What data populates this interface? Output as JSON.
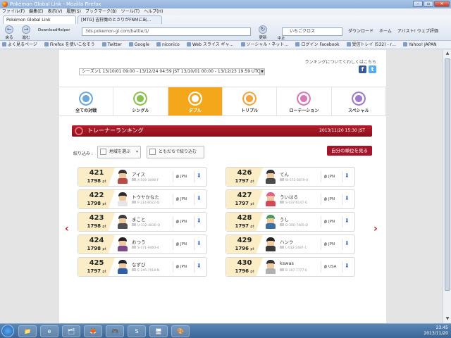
{
  "window": {
    "title": "Pokémon Global Link - Mozilla Firefox",
    "buttons": [
      "–",
      "▫",
      "✕"
    ]
  },
  "menubar": [
    "ファイル(F)",
    "編集(E)",
    "表示(V)",
    "履歴(S)",
    "ブックマーク(B)",
    "ツール(T)",
    "ヘルプ(H)"
  ],
  "tabs": [
    {
      "label": "Pokémon Global Link",
      "active": true
    },
    {
      "label": "[MTG] 吉狩魔のとさりがFNMに出…",
      "active": false
    }
  ],
  "nav": {
    "back": "戻る",
    "forward": "進む",
    "download_helper": "DownloadHelper",
    "reload": "更新",
    "stop": "中止",
    "download": "ダウンロード",
    "home": "ホーム",
    "avast": "アバスト! ウェブ評価"
  },
  "url": "3ds.pokemon-gl.com/battle/1/",
  "search": "いちごクロス",
  "bookmarks": [
    "よく見るページ",
    "Firefox を使いこなそう",
    "Twitter",
    "Google",
    "niconico",
    "Web スライス ギャ…",
    "ソーシャル・ネット…",
    "ログイン Facebook",
    "受信トレイ (532) - r…",
    "Yahoo! JAPAN"
  ],
  "page": {
    "ranking_info": "ランキングについてくわしくはこちら",
    "season": "シーズン1  13/10/01 09:00 - 13/12/24 04:59 JST  13/10/01 00:00 - 13/12/23 19:59 UTC",
    "categories": [
      {
        "label": "全ての対戦",
        "color": "#6fa8d8",
        "active": false
      },
      {
        "label": "シングル",
        "color": "#8cc152",
        "active": false
      },
      {
        "label": "ダブル",
        "color": "#ffffff",
        "active": true
      },
      {
        "label": "トリプル",
        "color": "#f2a541",
        "active": false
      },
      {
        "label": "ローテーション",
        "color": "#d97ab5",
        "active": false
      },
      {
        "label": "スペシャル",
        "color": "#9c7bd0",
        "active": false
      }
    ],
    "ranking_title": "トレーナーランキング",
    "ranking_date": "2013/11/20 15:30 JST",
    "filter_label": "絞り込み :",
    "filter_region": "地域を選ぶ",
    "filter_friends": "ともだちで絞り込む",
    "my_rank_button": "自分の順位を見る",
    "prev": "‹",
    "next": "›",
    "left_column": [
      {
        "rank": "421",
        "points": "1798",
        "unit": "pt",
        "name": "アイス",
        "id": "X-509-3098-F",
        "country": "JPN",
        "hat": "#333",
        "shirt": "#b84a4a"
      },
      {
        "rank": "422",
        "points": "1798",
        "unit": "pt",
        "name": "トウヤかなた",
        "id": "F-214-6022-Q",
        "country": "JPN",
        "hat": "#2b2b2b",
        "shirt": "#e6e6e6"
      },
      {
        "rank": "423",
        "points": "1798",
        "unit": "pt",
        "name": "まこと",
        "id": "U-312-4836-Q",
        "country": "JPN",
        "hat": "#3a3a3a",
        "shirt": "#505050"
      },
      {
        "rank": "424",
        "points": "1798",
        "unit": "pt",
        "name": "おつう",
        "id": "S-371-9460-4",
        "country": "JPN",
        "hat": "#222",
        "shirt": "#7a4a8a"
      },
      {
        "rank": "425",
        "points": "1797",
        "unit": "pt",
        "name": "なずび",
        "id": "E-245-7018-N",
        "country": "JPN",
        "hat": "#222",
        "shirt": "#2e5fa8"
      }
    ],
    "right_column": [
      {
        "rank": "426",
        "points": "1797",
        "unit": "pt",
        "name": "てん",
        "id": "W-572-6879-0",
        "country": "JPN",
        "hat": "#333",
        "shirt": "#4a4a4a"
      },
      {
        "rank": "427",
        "points": "1797",
        "unit": "pt",
        "name": "ういはる",
        "id": "S-437-6147-G",
        "country": "JPN",
        "hat": "#e85a8a",
        "shirt": "#d4475c"
      },
      {
        "rank": "428",
        "points": "1797",
        "unit": "pt",
        "name": "うし",
        "id": "D-390-7405-D",
        "country": "JPN",
        "hat": "#4a9a5a",
        "shirt": "#3a6fa0"
      },
      {
        "rank": "429",
        "points": "1796",
        "unit": "pt",
        "name": "ハンク",
        "id": "L-012-2487-1",
        "country": "JPN",
        "hat": "#222",
        "shirt": "#3a3a3a"
      },
      {
        "rank": "430",
        "points": "1796",
        "unit": "pt",
        "name": "kswas",
        "id": "B-397-7777-0",
        "country": "USA",
        "hat": "#333",
        "shirt": "#b0b0b0"
      }
    ]
  },
  "taskbar": {
    "apps": [
      "📁",
      "e",
      "🗂",
      "🦊",
      "🎮",
      "S",
      "🖥",
      "🎨"
    ],
    "time": "23:45",
    "date": "2013/11/20"
  }
}
